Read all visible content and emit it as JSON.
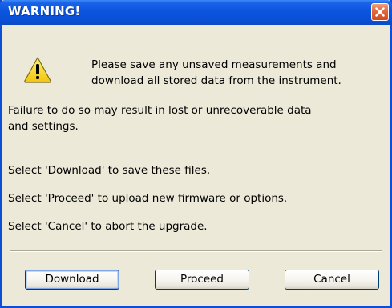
{
  "window": {
    "title": "WARNING!"
  },
  "message": {
    "line1": "Please save any unsaved measurements and",
    "line2": "download all stored data from the instrument.",
    "failure_line1": "Failure to do so may result in lost or unrecoverable data",
    "failure_line2": "and settings.",
    "select_download": "Select 'Download' to save these files.",
    "select_proceed": "Select 'Proceed' to upload new firmware or options.",
    "select_cancel": "Select 'Cancel' to abort the upgrade."
  },
  "buttons": {
    "download": "Download",
    "proceed": "Proceed",
    "cancel": "Cancel"
  },
  "icons": {
    "warning": "warning-triangle-icon",
    "close": "close-icon"
  },
  "colors": {
    "titlebar": "#0a4fd6",
    "close": "#d4491f",
    "warning_yellow": "#f7d21a",
    "dialog_bg": "#ece9d8"
  }
}
